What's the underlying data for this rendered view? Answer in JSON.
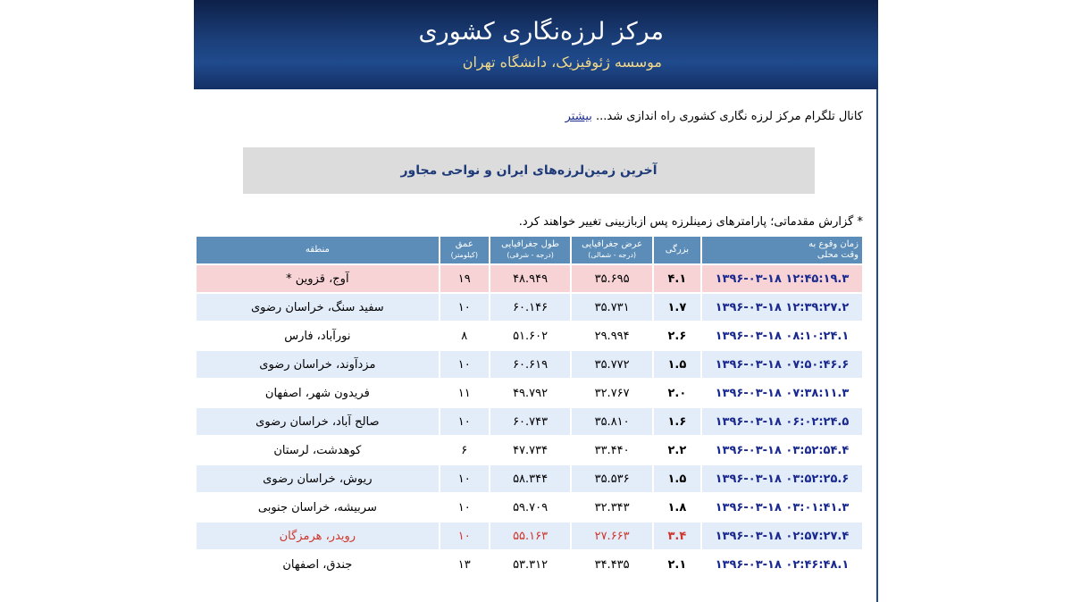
{
  "header": {
    "title": "مرکز لرزه‌نگاری کشوری",
    "subtitle": "موسسه ژئوفیزیک، دانشگاه تهران"
  },
  "notice": {
    "text": "کانال تلگرام مرکز لرزه نگاری کشوری راه اندازی شد...",
    "link_label": "بیشتر"
  },
  "banner": {
    "text": "آخرین زمین‌لرزه‌های ایران و نواحی مجاور"
  },
  "note": "* گزارش مقدماتی؛ پارامترهای زمینلرزه پس ازبازبینی تغییر خواهند کرد.",
  "table": {
    "headers": {
      "time_line1": "زمان وقوع به",
      "time_line2": "وقت محلی",
      "magnitude": "بزرگی",
      "latitude": "عرض جغرافیایی",
      "latitude_sub": "(درجه - شمالی)",
      "longitude": "طول جغرافیایی",
      "longitude_sub": "(درجه - شرقی)",
      "depth": "عمق",
      "depth_sub": "(کیلومتر)",
      "region": "منطقه"
    },
    "rows": [
      {
        "time": "۱۳۹۶-۰۳-۱۸ ۱۲:۴۵:۱۹.۳",
        "mag": "۴.۱",
        "lat": "۳۵.۶۹۵",
        "lon": "۴۸.۹۴۹",
        "depth": "۱۹",
        "region": "آوج، قزوین *"
      },
      {
        "time": "۱۳۹۶-۰۳-۱۸ ۱۲:۳۹:۲۷.۲",
        "mag": "۱.۷",
        "lat": "۳۵.۷۳۱",
        "lon": "۶۰.۱۴۶",
        "depth": "۱۰",
        "region": "سفید سنگ، خراسان رضوی"
      },
      {
        "time": "۱۳۹۶-۰۳-۱۸ ۰۸:۱۰:۲۴.۱",
        "mag": "۲.۶",
        "lat": "۲۹.۹۹۴",
        "lon": "۵۱.۶۰۲",
        "depth": "۸",
        "region": "نورآباد، فارس"
      },
      {
        "time": "۱۳۹۶-۰۳-۱۸ ۰۷:۵۰:۴۶.۶",
        "mag": "۱.۵",
        "lat": "۳۵.۷۷۲",
        "lon": "۶۰.۶۱۹",
        "depth": "۱۰",
        "region": "مزدآوند، خراسان رضوی"
      },
      {
        "time": "۱۳۹۶-۰۳-۱۸ ۰۷:۳۸:۱۱.۳",
        "mag": "۲.۰",
        "lat": "۳۲.۷۶۷",
        "lon": "۴۹.۷۹۲",
        "depth": "۱۱",
        "region": "فریدون شهر، اصفهان"
      },
      {
        "time": "۱۳۹۶-۰۳-۱۸ ۰۶:۰۲:۲۴.۵",
        "mag": "۱.۶",
        "lat": "۳۵.۸۱۰",
        "lon": "۶۰.۷۴۳",
        "depth": "۱۰",
        "region": "صالح آباد، خراسان رضوی"
      },
      {
        "time": "۱۳۹۶-۰۳-۱۸ ۰۳:۵۲:۵۴.۴",
        "mag": "۲.۲",
        "lat": "۳۳.۴۴۰",
        "lon": "۴۷.۷۳۴",
        "depth": "۶",
        "region": "کوهدشت، لرستان"
      },
      {
        "time": "۱۳۹۶-۰۳-۱۸ ۰۳:۵۲:۲۵.۶",
        "mag": "۱.۵",
        "lat": "۳۵.۵۳۶",
        "lon": "۵۸.۳۴۴",
        "depth": "۱۰",
        "region": "ریوش، خراسان رضوی"
      },
      {
        "time": "۱۳۹۶-۰۳-۱۸ ۰۳:۰۱:۴۱.۳",
        "mag": "۱.۸",
        "lat": "۳۲.۳۴۳",
        "lon": "۵۹.۷۰۹",
        "depth": "۱۰",
        "region": "سربیشه، خراسان جنوبی"
      },
      {
        "time": "۱۳۹۶-۰۳-۱۸ ۰۲:۵۷:۲۷.۴",
        "mag": "۳.۴",
        "lat": "۲۷.۶۶۳",
        "lon": "۵۵.۱۶۳",
        "depth": "۱۰",
        "region": "رویدر، هرمزگان"
      },
      {
        "time": "۱۳۹۶-۰۳-۱۸ ۰۲:۴۶:۴۸.۱",
        "mag": "۲.۱",
        "lat": "۳۴.۴۳۵",
        "lon": "۵۳.۳۱۲",
        "depth": "۱۳",
        "region": "جندق، اصفهان"
      }
    ]
  },
  "colors": {
    "header_dark": "#0d2048",
    "header_light": "#1f4a8c",
    "subtitle": "#f2d98a",
    "table_header": "#5b8db8",
    "row_alt": "#e3ecf9",
    "row_highlight": "#f7d3d6",
    "time_text": "#1a2a8f",
    "alert_text": "#d0372c"
  }
}
